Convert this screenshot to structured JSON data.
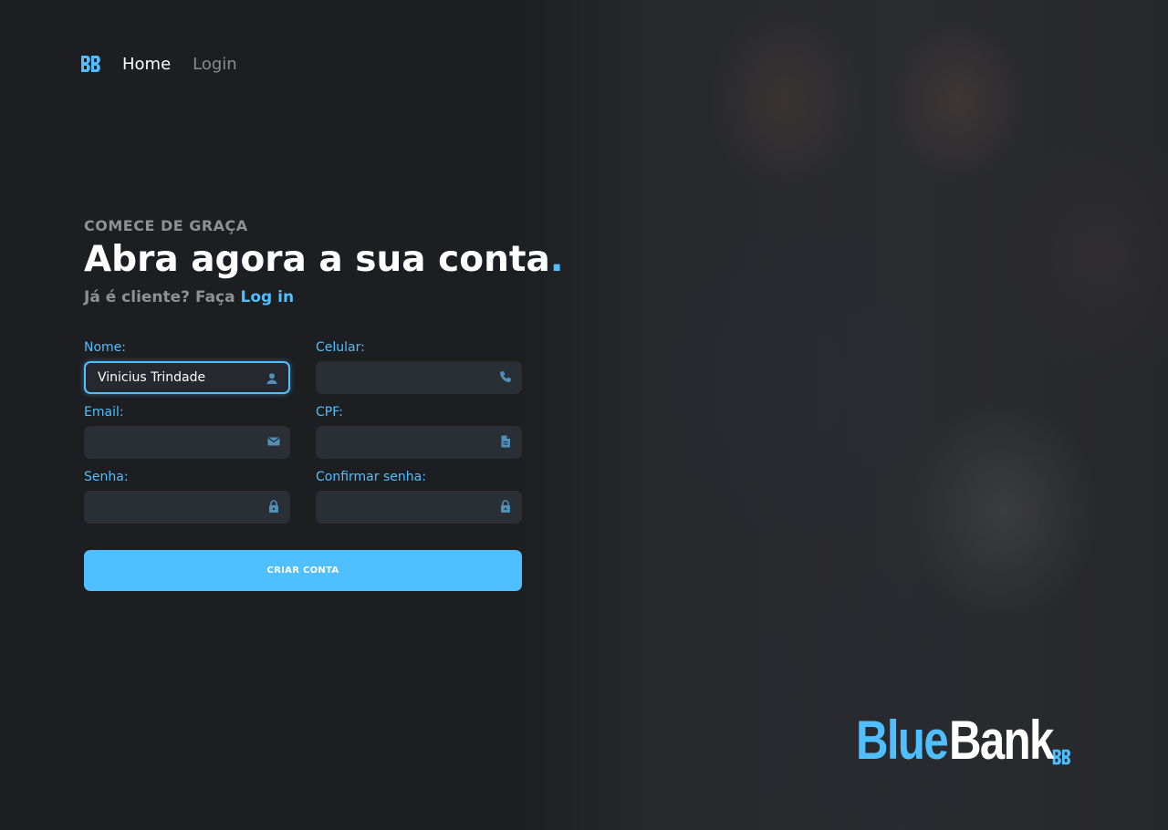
{
  "nav": {
    "home": "Home",
    "login": "Login"
  },
  "hero": {
    "eyebrow": "COMECE DE GRAÇA",
    "headline": "Abra agora a sua conta",
    "headline_dot": ".",
    "sub_prefix": "Já é cliente? Faça",
    "sub_link": "Log in"
  },
  "form": {
    "nome": {
      "label": "Nome:",
      "value": "Vinicius Trindade",
      "icon": "user-icon"
    },
    "celular": {
      "label": "Celular:",
      "value": "",
      "icon": "phone-icon"
    },
    "email": {
      "label": "Email:",
      "value": "",
      "icon": "envelope-icon"
    },
    "cpf": {
      "label": "CPF:",
      "value": "",
      "icon": "document-icon"
    },
    "senha": {
      "label": "Senha:",
      "value": "",
      "icon": "lock-icon"
    },
    "confirmar": {
      "label": "Confirmar senha:",
      "value": "",
      "icon": "lock-icon"
    },
    "submit": "CRIAR CONTA"
  },
  "brand": {
    "part1": "Blue",
    "part2": "Bank"
  },
  "colors": {
    "accent": "#4fbfff",
    "background": "#1d1e21",
    "input": "#2a2e35"
  }
}
